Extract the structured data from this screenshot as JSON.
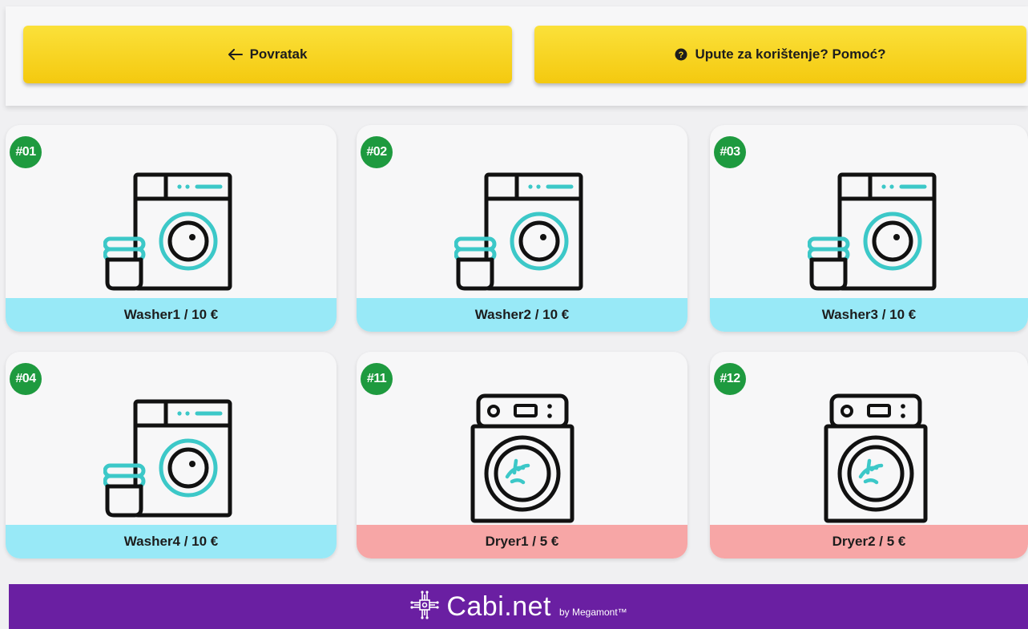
{
  "header": {
    "back_label": "Povratak",
    "help_label": "Upute za korištenje? Pomoć?",
    "back_icon": "arrow-left-icon",
    "help_icon": "question-circle-icon"
  },
  "machines": [
    {
      "badge": "#01",
      "label": "Washer1 / 10 €",
      "type": "washer"
    },
    {
      "badge": "#02",
      "label": "Washer2 / 10 €",
      "type": "washer"
    },
    {
      "badge": "#03",
      "label": "Washer3 / 10 €",
      "type": "washer"
    },
    {
      "badge": "#04",
      "label": "Washer4 / 10 €",
      "type": "washer"
    },
    {
      "badge": "#11",
      "label": "Dryer1 / 5 €",
      "type": "dryer"
    },
    {
      "badge": "#12",
      "label": "Dryer2 / 5 €",
      "type": "dryer"
    }
  ],
  "footer": {
    "brand": "Cabi.net",
    "by": "by Megamont™",
    "logo_icon": "circuit-chip-icon"
  },
  "colors": {
    "button_yellow": "#f7d21e",
    "badge_green": "#1e9a3f",
    "washer_label": "#98e9f7",
    "dryer_label": "#f7a6a6",
    "footer_purple": "#6a1fa2",
    "icon_accent": "#3cc8c8"
  }
}
